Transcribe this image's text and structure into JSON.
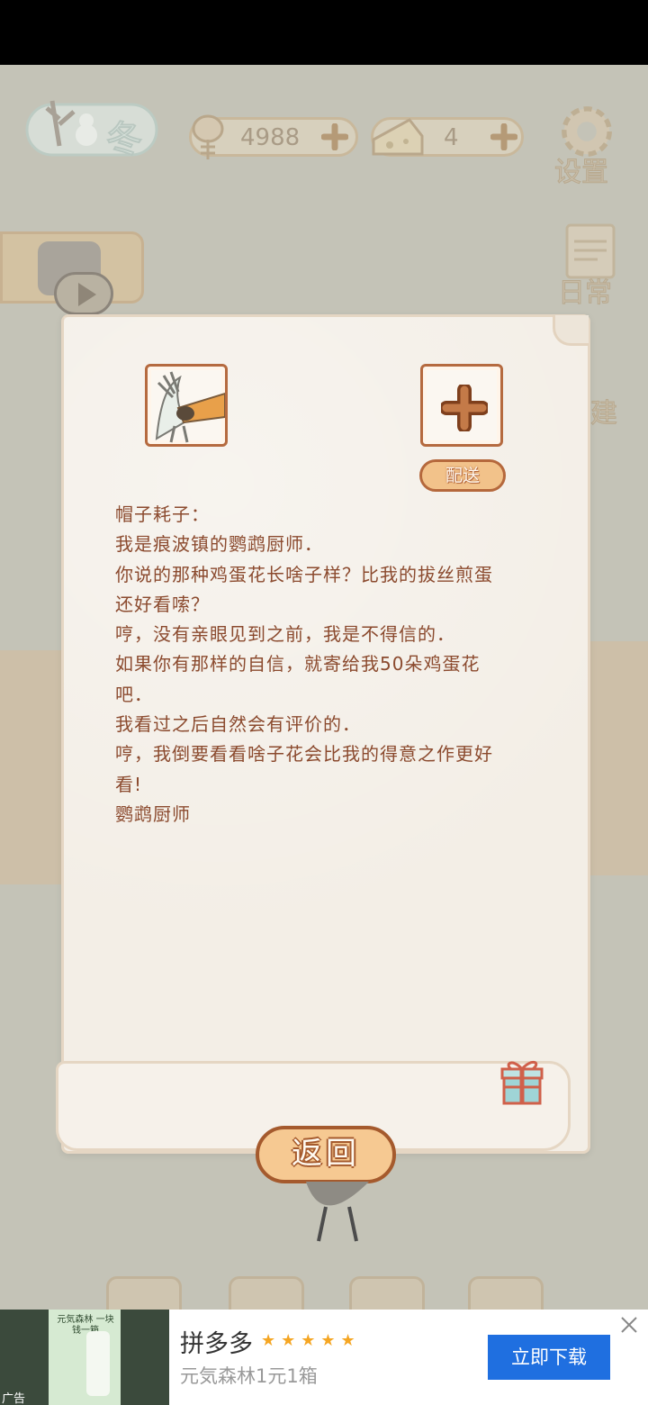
{
  "hud": {
    "season_label": "冬",
    "fish_count": "4988",
    "cheese_count": "4",
    "settings_label": "设置",
    "daily_label": "日常",
    "build_label": "建"
  },
  "letter": {
    "lines": [
      "帽子耗子：",
      "我是痕波镇的鹦鹉厨师．",
      "你说的那种鸡蛋花长啥子样？比我的拔丝煎蛋",
      "还好看嗦？",
      "哼，没有亲眼见到之前，我是不得信的．",
      "如果你有那样的自信，就寄给我50朵鸡蛋花",
      "吧．",
      "我看过之后自然会有评价的．",
      "哼，我倒要看看啥子花会比我的得意之作更好",
      "看!",
      "鹦鹉厨师"
    ],
    "deliver_label": "配送",
    "back_label": "返回"
  },
  "ad": {
    "tag": "广告",
    "title": "拼多多",
    "rating_stars": "★★★★★",
    "subtitle": "元気森林1元1箱",
    "cta": "立即下载",
    "thumb_text": "元気森林 一块钱一箱"
  },
  "colors": {
    "letter_text": "#8b4a2e",
    "button_fill": "#f2c28a",
    "button_border": "#b5683c",
    "ad_cta": "#1f6fe0"
  }
}
